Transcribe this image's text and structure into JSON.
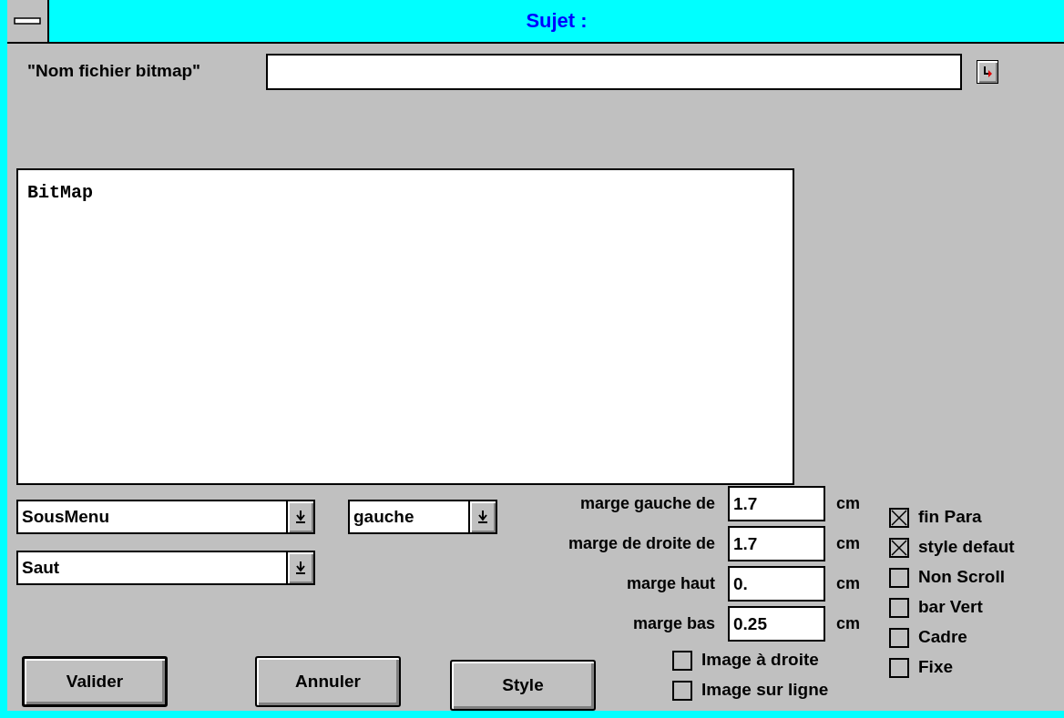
{
  "window": {
    "title": "Sujet :"
  },
  "file_field": {
    "label": "\"Nom fichier bitmap\""
  },
  "text_area": {
    "value": "BitMap"
  },
  "combos": [
    {
      "value": "SousMenu"
    },
    {
      "value": "gauche"
    },
    {
      "value": "Saut"
    }
  ],
  "margins": [
    {
      "label": "marge gauche de",
      "value": "1.7",
      "unit": "cm"
    },
    {
      "label": "marge de droite de",
      "value": "1.7",
      "unit": "cm"
    },
    {
      "label": "marge haut",
      "value": "0.",
      "unit": "cm"
    },
    {
      "label": "marge bas",
      "value": "0.25",
      "unit": "cm"
    }
  ],
  "buttons": [
    {
      "label": "Valider",
      "default": true
    },
    {
      "label": "Annuler",
      "default": false
    },
    {
      "label": "Style",
      "default": false
    }
  ],
  "image_options": [
    {
      "label": "Image à droite",
      "checked": false
    },
    {
      "label": "Image sur ligne",
      "checked": false
    }
  ],
  "flags": [
    {
      "label": "fin Para",
      "checked": true
    },
    {
      "label": "style defaut",
      "checked": true
    },
    {
      "label": "Non Scroll",
      "checked": false
    },
    {
      "label": "bar Vert",
      "checked": false
    },
    {
      "label": "Cadre",
      "checked": false
    },
    {
      "label": "Fixe",
      "checked": false
    }
  ]
}
